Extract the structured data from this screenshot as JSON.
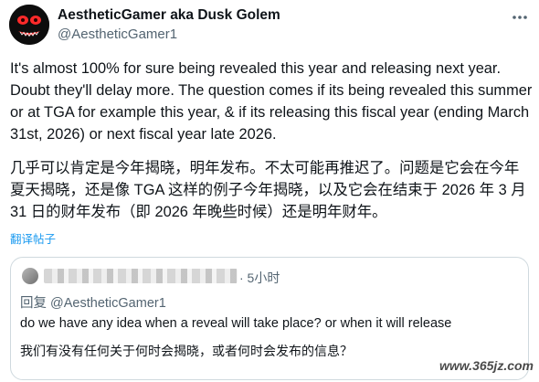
{
  "author": {
    "display_name": "AestheticGamer aka Dusk Golem",
    "handle": "@AestheticGamer1",
    "avatar_icon": "demon-face-avatar"
  },
  "tweet": {
    "text_en": "It's almost 100% for sure being revealed this year and releasing next year. Doubt they'll delay more. The question comes if its being revealed this summer or at TGA for example this year, & if its releasing this fiscal year (ending March 31st, 2026) or next fiscal year late 2026.",
    "text_zh": "几乎可以肯定是今年揭晓，明年发布。不太可能再推迟了。问题是它会在今年夏天揭晓，还是像 TGA 这样的例子今年揭晓，以及它会在结束于 2026 年 3 月 31 日的财年发布（即 2026 年晚些时候）还是明年财年。",
    "translate_label": "翻译帖子"
  },
  "quoted": {
    "time": "· 5小时",
    "reply_prefix": "回复 ",
    "reply_mention": "@AestheticGamer1",
    "text_en": "do we have any idea when a reveal will take place? or when it will release",
    "text_zh": "我们有没有任何关于何时会揭晓，或者何时会发布的信息？"
  },
  "watermark": "www.365jz.com",
  "colors": {
    "link": "#1d9bf0",
    "secondary": "#536471",
    "border": "#cfd9de"
  }
}
